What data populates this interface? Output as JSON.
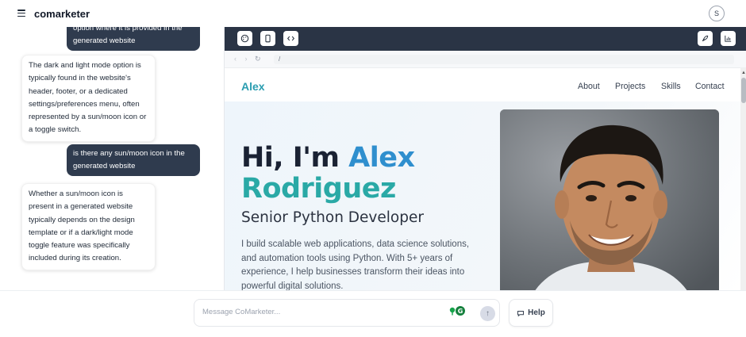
{
  "header": {
    "app_title": "comarketer",
    "user_initial": "S"
  },
  "chat": {
    "messages": [
      {
        "role": "user",
        "text": "option where it is provided in the generated website"
      },
      {
        "role": "assistant",
        "text": "The dark and light mode option is typically found in the website's header, footer, or a dedicated settings/preferences menu, often represented by a sun/moon icon or a toggle switch."
      },
      {
        "role": "user",
        "text": "is there any sun/moon icon in the generated website"
      },
      {
        "role": "assistant",
        "text": "Whether a sun/moon icon is present in a generated website typically depends on the design template or if a dark/light mode toggle feature was specifically included during its creation."
      }
    ]
  },
  "preview": {
    "toolbar_icons": [
      "palette-icon",
      "mobile-icon",
      "code-icon",
      "rocket-icon",
      "analytics-icon"
    ],
    "address": "/",
    "site": {
      "logo": "Alex",
      "nav": [
        "About",
        "Projects",
        "Skills",
        "Contact"
      ],
      "hero_greeting": "Hi, I'm",
      "hero_first_name": "Alex",
      "hero_last_name": "Rodriguez",
      "hero_subtitle": "Senior Python Developer",
      "hero_description": "I build scalable web applications, data science solutions, and automation tools using Python. With 5+ years of experience, I help businesses transform their ideas into powerful digital solutions."
    }
  },
  "composer": {
    "placeholder": "Message CoMarketer...",
    "help_label": "Help"
  }
}
